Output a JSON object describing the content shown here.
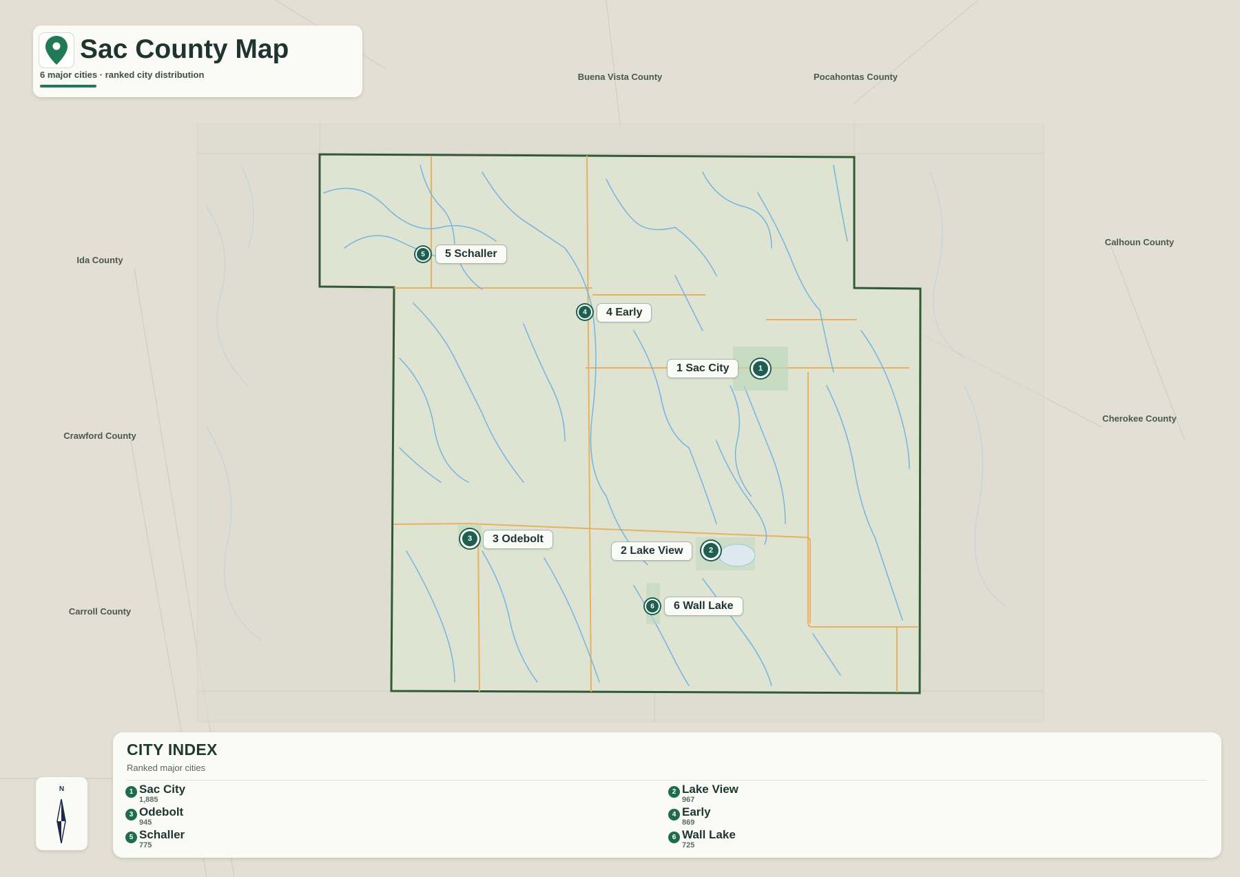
{
  "header": {
    "title": "Sac County Map",
    "subtitle": "6 major cities · ranked city distribution",
    "icon": "map-pin-icon",
    "accent_color": "#1f7a55"
  },
  "neighbors": [
    {
      "name": "Buena Vista County"
    },
    {
      "name": "Pocahontas County"
    },
    {
      "name": "Ida County"
    },
    {
      "name": "Calhoun County"
    },
    {
      "name": "Crawford County"
    },
    {
      "name": "Cherokee County"
    },
    {
      "name": "Carroll County"
    }
  ],
  "cities": [
    {
      "rank": "1",
      "name": "Sac City",
      "label": "1 Sac City",
      "population": "1,885"
    },
    {
      "rank": "2",
      "name": "Lake View",
      "label": "2 Lake View",
      "population": "967"
    },
    {
      "rank": "3",
      "name": "Odebolt",
      "label": "3 Odebolt",
      "population": "945"
    },
    {
      "rank": "4",
      "name": "Early",
      "label": "4 Early",
      "population": "869"
    },
    {
      "rank": "5",
      "name": "Schaller",
      "label": "5 Schaller",
      "population": "775"
    },
    {
      "rank": "6",
      "name": "Wall Lake",
      "label": "6 Wall Lake",
      "population": "725"
    }
  ],
  "index": {
    "title": "CITY INDEX",
    "subtitle": "Ranked major cities"
  },
  "compass": {
    "label": "N",
    "icon": "north-arrow-icon"
  },
  "colors": {
    "county_border": "#2f5a33",
    "county_fill": "#dfe3d2",
    "rivers": "#73b4e0",
    "roads": "#e7b164",
    "marker": "#1f5f4f",
    "background": "#e3dfd4"
  }
}
